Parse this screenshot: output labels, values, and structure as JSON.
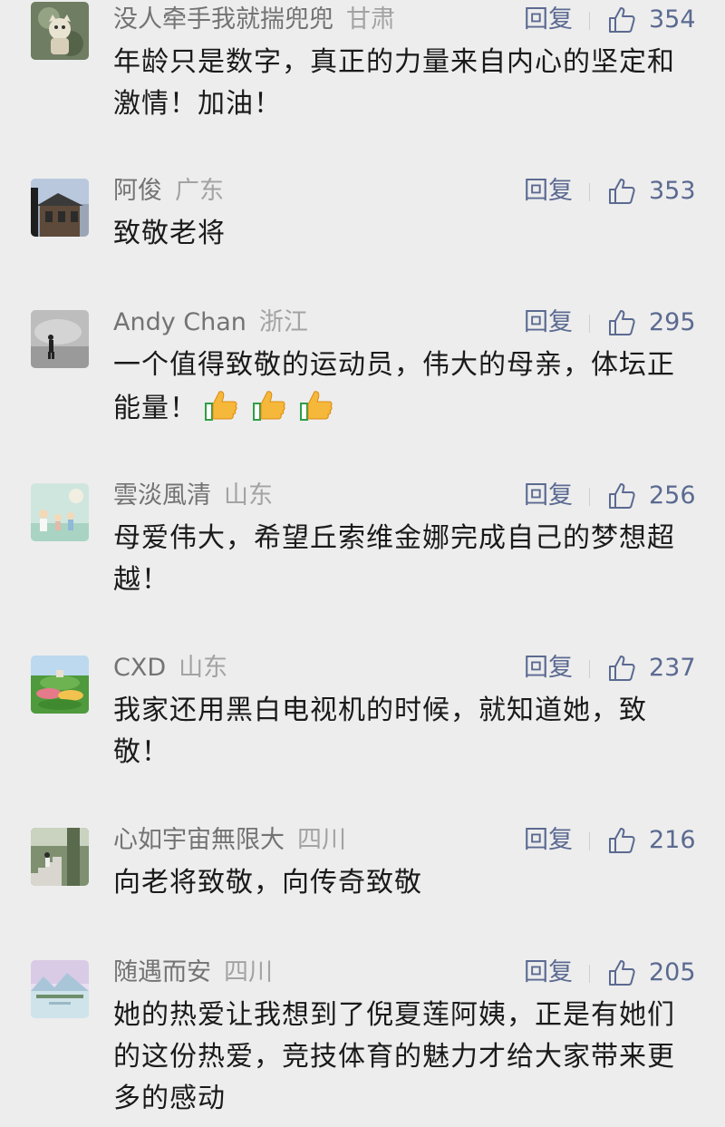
{
  "reply_label": "回复",
  "comments": [
    {
      "nickname": "没人牵手我就揣兜兜",
      "region": "甘肃",
      "likes": "354",
      "text": "年龄只是数字，真正的力量来自内心的坚定和激情！加油！",
      "avatar": "avatar-cartoon"
    },
    {
      "nickname": "阿俊",
      "region": "广东",
      "likes": "353",
      "text": "致敬老将",
      "avatar": "avatar-building"
    },
    {
      "nickname": "Andy Chan",
      "region": "浙江",
      "likes": "295",
      "text": "一个值得致敬的运动员，伟大的母亲，体坛正能量！",
      "emoji": [
        "thumbs-up",
        "thumbs-up",
        "thumbs-up"
      ],
      "avatar": "avatar-fog-figure"
    },
    {
      "nickname": "雲淡風清",
      "region": "山东",
      "likes": "256",
      "text": "母爱伟大，希望丘索维金娜完成自己的梦想超越！",
      "avatar": "avatar-illustration"
    },
    {
      "nickname": "CXD",
      "region": "山东",
      "likes": "237",
      "text": "我家还用黑白电视机的时候，就知道她，致敬！",
      "avatar": "avatar-garden"
    },
    {
      "nickname": "心如宇宙無限大",
      "region": "四川",
      "likes": "216",
      "text": "向老将致敬，向传奇致敬",
      "avatar": "avatar-stairs"
    },
    {
      "nickname": "随遇而安",
      "region": "四川",
      "likes": "205",
      "text": "她的热爱让我想到了倪夏莲阿姨，正是有她们的这份热爱，竞技体育的魅力才给大家带来更多的感动",
      "avatar": "avatar-lake-landscape"
    }
  ],
  "colors": {
    "background": "#ededed",
    "nickname": "#737373",
    "region": "#a3a3a3",
    "action": "#5b6a91",
    "text": "#1a1a1a"
  }
}
